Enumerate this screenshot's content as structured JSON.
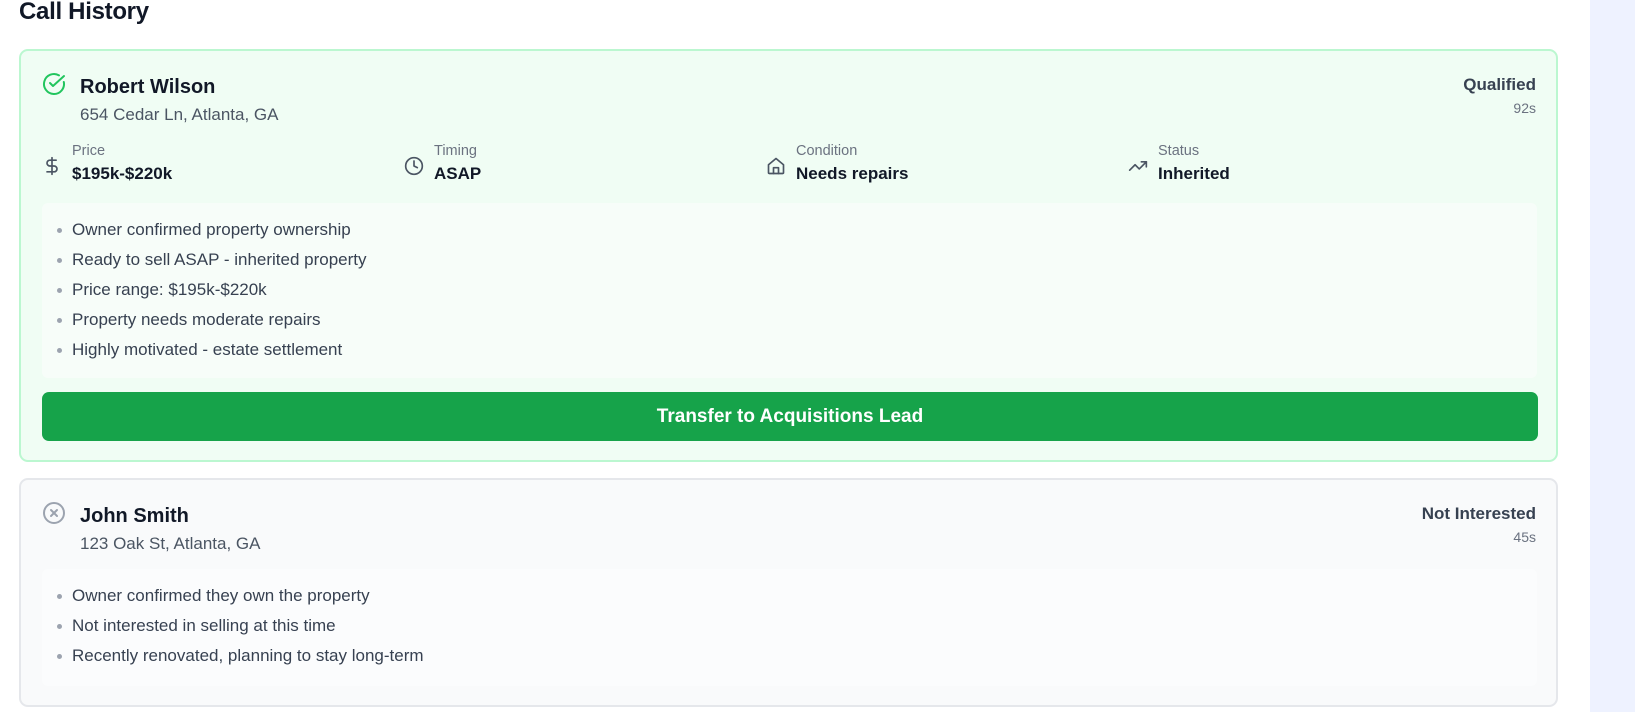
{
  "header": {
    "title": "Call History"
  },
  "calls": [
    {
      "name": "Robert Wilson",
      "address": "654 Cedar Ln, Atlanta, GA",
      "outcome": "Qualified",
      "duration": "92s",
      "status_icon": "check-circle-icon",
      "accent_color": "#16a34a",
      "metrics": [
        {
          "icon": "dollar-icon",
          "label": "Price",
          "value": "$195k-$220k"
        },
        {
          "icon": "clock-icon",
          "label": "Timing",
          "value": "ASAP"
        },
        {
          "icon": "home-icon",
          "label": "Condition",
          "value": "Needs repairs"
        },
        {
          "icon": "trending-up-icon",
          "label": "Status",
          "value": "Inherited"
        }
      ],
      "notes": [
        "Owner confirmed property ownership",
        "Ready to sell ASAP - inherited property",
        "Price range: $195k-$220k",
        "Property needs moderate repairs",
        "Highly motivated - estate settlement"
      ],
      "action_label": "Transfer to Acquisitions Lead"
    },
    {
      "name": "John Smith",
      "address": "123 Oak St, Atlanta, GA",
      "outcome": "Not Interested",
      "duration": "45s",
      "status_icon": "x-circle-icon",
      "accent_color": "#9ca3af",
      "notes": [
        "Owner confirmed they own the property",
        "Not interested in selling at this time",
        "Recently renovated, planning to stay long-term"
      ]
    }
  ]
}
